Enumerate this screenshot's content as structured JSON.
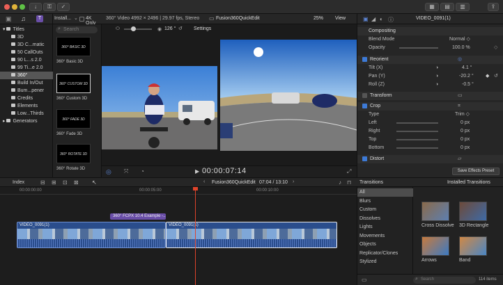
{
  "toolbar": {
    "import_label": "Install...",
    "filter_4k_label": "4K Only",
    "clip_info": "360° Video 4992 × 2496 | 29.97 fps, Stereo",
    "project_name": "Fusion360QuickEdit",
    "zoom": "25%",
    "view_label": "View",
    "inspector_clip_name": "VIDEO_0091(1)"
  },
  "libraries": {
    "items": [
      {
        "label": "Titles"
      },
      {
        "label": "3D"
      },
      {
        "label": "3D C...matic"
      },
      {
        "label": "50 CallOuts"
      },
      {
        "label": "90 L...s 2.0"
      },
      {
        "label": "99 Ti...e 2.0"
      },
      {
        "label": "360°"
      },
      {
        "label": "Build In/Out"
      },
      {
        "label": "Bum...pener"
      },
      {
        "label": "Credits"
      },
      {
        "label": "Elements"
      },
      {
        "label": "Low...Thirds"
      },
      {
        "label": "Generators"
      }
    ]
  },
  "browser": {
    "search_placeholder": "Search",
    "items": [
      {
        "thumb_text": "360° BASIC 3D",
        "label": "360° Basic 3D"
      },
      {
        "thumb_text": "360° CUSTOM 3D",
        "label": "360° Custom 3D"
      },
      {
        "thumb_text": "360° FADE 3D",
        "label": "360° Fade 3D"
      },
      {
        "thumb_text": "360° ROTATE 3D",
        "label": "360° Rotate 3D"
      }
    ]
  },
  "viewer": {
    "angle_value": "126 °",
    "settings_label": "Settings",
    "timecode": "00:00:07:14"
  },
  "inspector": {
    "compositing_label": "Compositing",
    "blend_mode_label": "Blend Mode",
    "blend_mode_value": "Normal ◇",
    "opacity_label": "Opacity",
    "opacity_value": "100.0 %",
    "reorient_label": "Reorient",
    "tilt_label": "Tilt (X)",
    "tilt_value": "4.1 °",
    "pan_label": "Pan (Y)",
    "pan_value": "-20.2 °",
    "roll_label": "Roll (Z)",
    "roll_value": "-0.5 °",
    "transform_label": "Transform",
    "crop_label": "Crop",
    "type_label": "Type",
    "type_value": "Trim ◇",
    "left_label": "Left",
    "left_value": "0 px",
    "right_label": "Right",
    "right_value": "0 px",
    "top_label": "Top",
    "top_value": "0 px",
    "bottom_label": "Bottom",
    "bottom_value": "0 px",
    "distort_label": "Distort",
    "save_preset_label": "Save Effects Preset"
  },
  "timeline": {
    "index_label": "Index",
    "project_name": "Fusion360QuickEdit",
    "duration": "07:04 / 13:10",
    "ruler": [
      "00:00:00:00",
      "00:00:05:00",
      "00:00:10:00"
    ],
    "title_clip": "360° FCPX 10.4 Example -...",
    "clip1": "VIDEO_0091(1)",
    "clip2": "VIDEO_0091(1)"
  },
  "transitions": {
    "header": "Transitions",
    "installed_label": "Installed Transitions",
    "categories": [
      "All",
      "Blurs",
      "Custom",
      "Dissolves",
      "Lights",
      "Movements",
      "Objects",
      "Replicator/Clones",
      "Stylized"
    ],
    "tiles": [
      {
        "label": "Cross Dissolve",
        "color_a": "#8a6a4a",
        "color_b": "#5d7fb0"
      },
      {
        "label": "3D Rectangle",
        "color_a": "#6d4a3a",
        "color_b": "#3e6aa6"
      },
      {
        "label": "Arrows",
        "color_a": "#c77a3d",
        "color_b": "#3c7ac2"
      },
      {
        "label": "Band",
        "color_a": "#d08845",
        "color_b": "#4a86c4"
      }
    ],
    "search_placeholder": "Search",
    "count": "114 items"
  },
  "colors": {
    "accent": "#3d7ad6",
    "selection": "#565656",
    "clip": "#2a4d8c",
    "title_clip": "#6a4ea8",
    "playhead": "#e0442b"
  }
}
